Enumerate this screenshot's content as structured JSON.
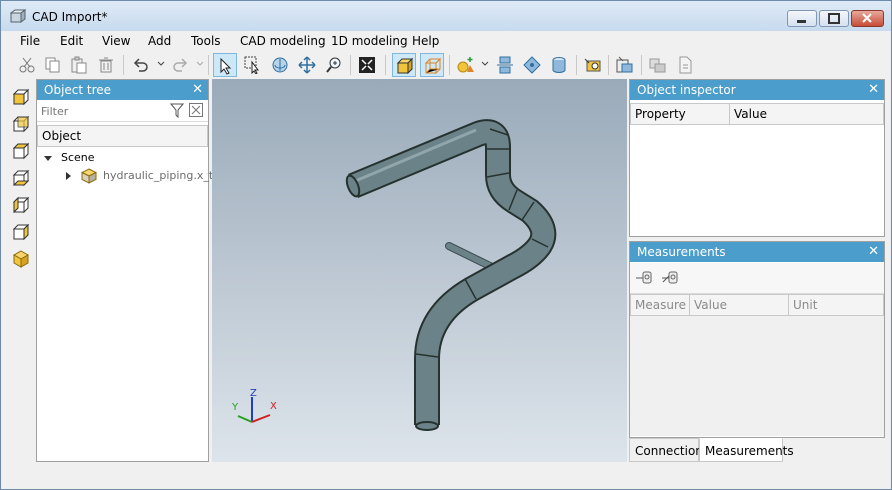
{
  "window": {
    "title": "CAD Import*",
    "controls": [
      "minimize-icon",
      "maximize-icon",
      "close-icon"
    ]
  },
  "menu": {
    "file": "File",
    "edit": "Edit",
    "view": "View",
    "add": "Add",
    "tools": "Tools",
    "cad_modeling": "CAD modeling",
    "one_d_modeling": "1D modeling",
    "help": "Help"
  },
  "toolbar": {
    "icons": [
      "cut-icon",
      "copy-icon",
      "paste-icon",
      "delete-icon",
      "undo-icon",
      "redo-icon",
      "select-icon",
      "box-select-icon",
      "rotate-icon",
      "pan-icon",
      "zoom-icon",
      "fit-icon",
      "solid-view-icon",
      "wireframe-view-icon",
      "add-shape-icon",
      "align-icon",
      "snap-icon",
      "cylinder-icon",
      "measure-icon",
      "import-icon",
      "export-icon",
      "document-icon"
    ],
    "accent": "#cde8f7"
  },
  "object_tree": {
    "title": "Object tree",
    "filter_placeholder": "Filter",
    "column": "Object",
    "items": [
      {
        "label": "Scene",
        "expanded": true
      },
      {
        "label": "hydraulic_piping.x_t",
        "expanded": false
      }
    ]
  },
  "object_inspector": {
    "title": "Object inspector",
    "columns": [
      "Property",
      "Value"
    ]
  },
  "measurements": {
    "title": "Measurements",
    "columns": [
      "Measure",
      "Value",
      "Unit"
    ]
  },
  "bottom_tabs": {
    "connections": "Connections",
    "measurements": "Measurements",
    "active": "Measurements"
  },
  "axes": {
    "x": "X",
    "y": "Y",
    "z": "Z"
  },
  "colors": {
    "panel_header": "#4b9ecb",
    "pipe": "#6b8288",
    "viewport_top": "#9aaab9",
    "viewport_bottom": "#dde4eb"
  }
}
